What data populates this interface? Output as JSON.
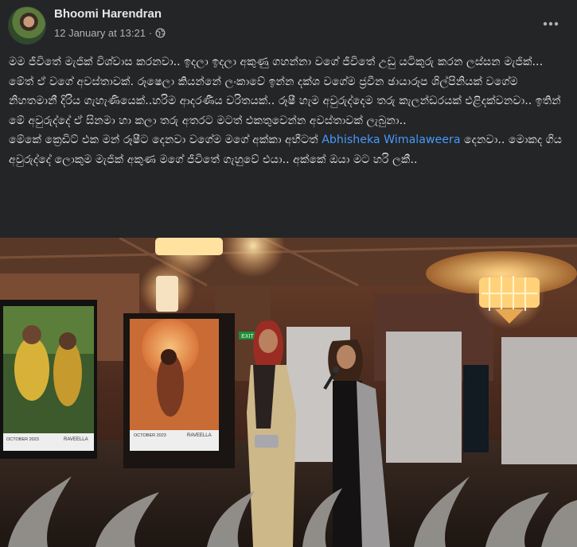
{
  "post": {
    "author": "Bhoomi Harendran",
    "timestamp": "12 January at 13:21",
    "separator": "·",
    "audience_icon": "globe-icon",
    "more_icon": "more-horizontal-icon",
    "paragraph1": "මම ජීවිතේ මැජික් විශ්වාස කරනවා.. ඉදලා ඉදලා අකුණු ගහන්නා වගේ ජීවිතේ උඩු යටිකුරු කරන ලස්සන මැජික්... මේත් ඒ වගේ අවස්තාවක්. රූෂෙලා කියන්නේ ලංකාවේ ඉන්න දක්ශ වගේම ජ්‍රවීන ඡායාරූප ශිල්පිනියක් වගේම නිහතමානී දිරිය ගැහැණියෙක්..හරිම ආදරණීය චරිතයක්.. රූෂී හැම අවුරුද්දෙම තරු කැලන්ඩරයක් එළිදක්වනවා.. ඉතින් මේ අවුරුද්දේ ඒ සිනමා හා කලා තරු අතරට මටත් එකතුවෙන්න අවස්තාවක් ලැබුනා..",
    "paragraph2_before": "මේකේ ක්‍රෙඩිට් එක මන් රූෂීට දෙනවා වගේම මගේ අක්කා අභීටත් ",
    "mention": "Abhisheka Wimalaweera",
    "paragraph2_after": " දෙනවා.. මොකද ගිය අවුරුද්දේ ලොකුම මැජික් අකුණ මගේ ජීවිතේ ගැහුවේ එයා.. අක්කේ ඔයා මට හරි ලකී..",
    "photo_text": {
      "exit_sign": "EXIT",
      "calendar_left_month": "OCTOBER 2023",
      "calendar_left_brand": "RAVEELLA",
      "calendar_right_month": "OCTOBER 2023",
      "calendar_right_brand": "RAVEELLA"
    }
  },
  "colors": {
    "background": "#242526",
    "text_primary": "#e4e6eb",
    "text_secondary": "#b0b3b8",
    "link": "#4599ff"
  }
}
